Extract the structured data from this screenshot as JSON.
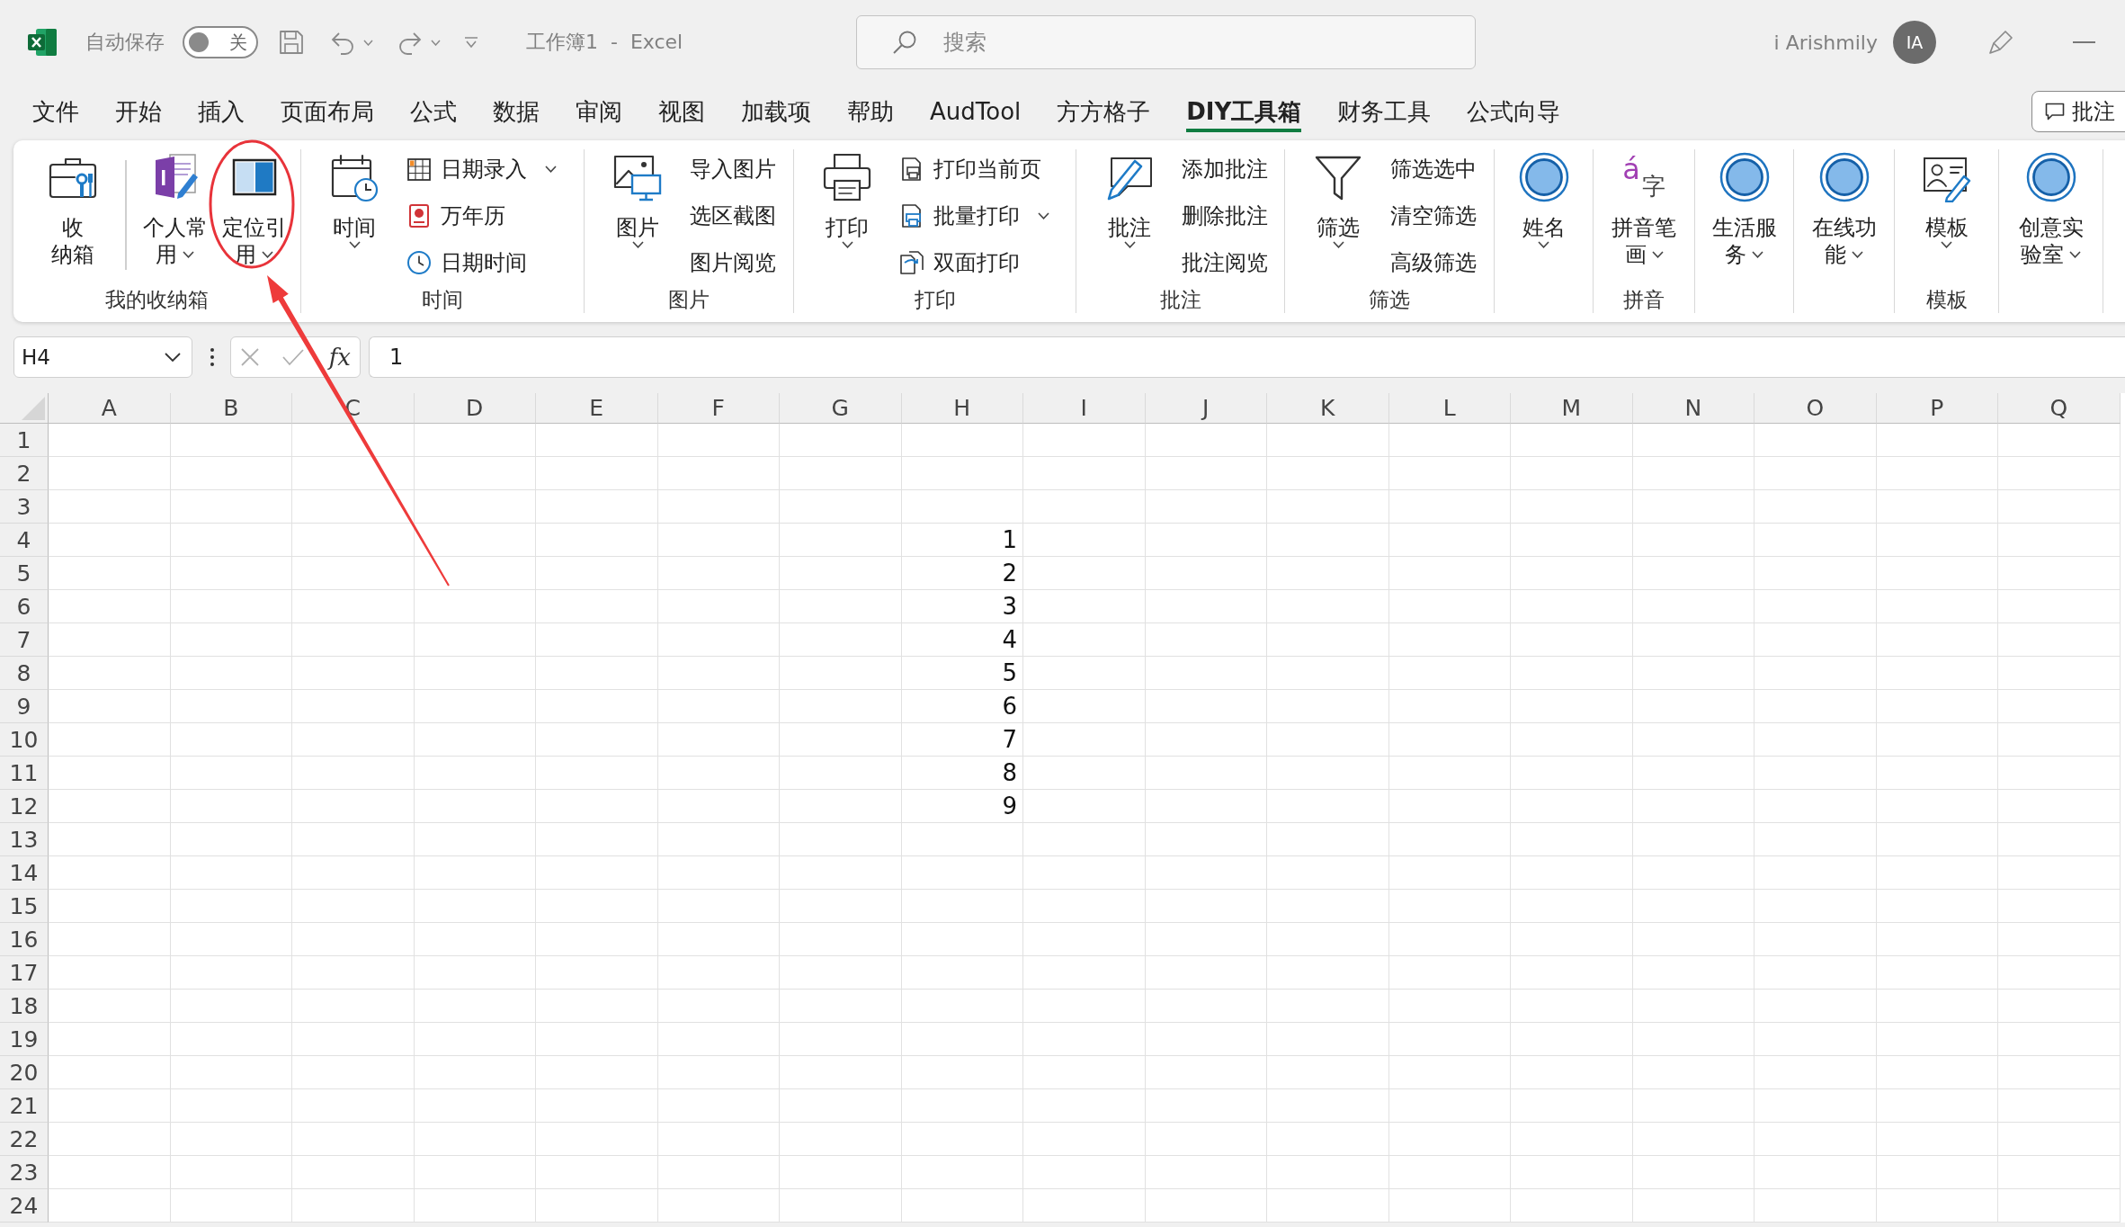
{
  "title_bar": {
    "autosave_label": "自动保存",
    "autosave": {
      "on": false,
      "label": "关"
    },
    "document_title": "工作簿1  -  Excel",
    "search": {
      "placeholder": "搜索"
    },
    "user_name": "i Arishmily",
    "avatar_initials": "IA"
  },
  "menu_tabs": [
    {
      "label": "文件",
      "selected": false
    },
    {
      "label": "开始",
      "selected": false
    },
    {
      "label": "插入",
      "selected": false
    },
    {
      "label": "页面布局",
      "selected": false
    },
    {
      "label": "公式",
      "selected": false
    },
    {
      "label": "数据",
      "selected": false
    },
    {
      "label": "审阅",
      "selected": false
    },
    {
      "label": "视图",
      "selected": false
    },
    {
      "label": "加载项",
      "selected": false
    },
    {
      "label": "帮助",
      "selected": false
    },
    {
      "label": "AudTool",
      "selected": false
    },
    {
      "label": "方方格子",
      "selected": false
    },
    {
      "label": "DIY工具箱",
      "selected": true
    },
    {
      "label": "财务工具",
      "selected": false
    },
    {
      "label": "公式向导",
      "selected": false
    }
  ],
  "comments_button": {
    "label": "批注"
  },
  "ribbon": {
    "groups": [
      {
        "label": "我的收纳箱",
        "items": [
          {
            "kind": "large",
            "lines": [
              "收",
              "纳箱"
            ],
            "dropdown": false
          },
          {
            "kind": "divider"
          },
          {
            "kind": "large",
            "lines": [
              "个人常",
              "用"
            ],
            "dropdown": true
          },
          {
            "kind": "large",
            "lines": [
              "定位引",
              "用"
            ],
            "dropdown": true
          }
        ]
      },
      {
        "label": "时间",
        "items": [
          {
            "kind": "large",
            "lines": [
              "时间"
            ],
            "dropdown": true
          },
          {
            "kind": "stack",
            "entries": [
              {
                "label": "日期录入",
                "dropdown": true
              },
              {
                "label": "万年历",
                "dropdown": false
              },
              {
                "label": "日期时间",
                "dropdown": false
              }
            ]
          }
        ]
      },
      {
        "label": "图片",
        "items": [
          {
            "kind": "large",
            "lines": [
              "图片"
            ],
            "dropdown": true
          },
          {
            "kind": "stack",
            "entries": [
              {
                "label": "导入图片",
                "dropdown": false
              },
              {
                "label": "选区截图",
                "dropdown": false
              },
              {
                "label": "图片阅览",
                "dropdown": false
              }
            ]
          }
        ]
      },
      {
        "label": "打印",
        "items": [
          {
            "kind": "large",
            "lines": [
              "打印"
            ],
            "dropdown": true
          },
          {
            "kind": "stack",
            "entries": [
              {
                "label": "打印当前页",
                "dropdown": false
              },
              {
                "label": "批量打印",
                "dropdown": true
              },
              {
                "label": "双面打印",
                "dropdown": false
              }
            ]
          }
        ]
      },
      {
        "label": "批注",
        "items": [
          {
            "kind": "large",
            "lines": [
              "批注"
            ],
            "dropdown": true
          },
          {
            "kind": "stack",
            "entries": [
              {
                "label": "添加批注",
                "dropdown": false
              },
              {
                "label": "删除批注",
                "dropdown": false
              },
              {
                "label": "批注阅览",
                "dropdown": false
              }
            ]
          }
        ]
      },
      {
        "label": "筛选",
        "items": [
          {
            "kind": "large",
            "lines": [
              "筛选"
            ],
            "dropdown": true
          },
          {
            "kind": "stack",
            "entries": [
              {
                "label": "筛选选中",
                "dropdown": false
              },
              {
                "label": "清空筛选",
                "dropdown": false
              },
              {
                "label": "高级筛选",
                "dropdown": false
              }
            ]
          }
        ]
      },
      {
        "items": [
          {
            "kind": "large",
            "lines": [
              "姓名"
            ],
            "dropdown": true
          }
        ]
      },
      {
        "label": "拼音",
        "items": [
          {
            "kind": "large",
            "lines": [
              "拼音笔",
              "画"
            ],
            "dropdown": true,
            "icon_glyphs": [
              "á",
              "字"
            ]
          }
        ]
      },
      {
        "items": [
          {
            "kind": "large",
            "lines": [
              "生活服",
              "务"
            ],
            "dropdown": true
          }
        ]
      },
      {
        "items": [
          {
            "kind": "large",
            "lines": [
              "在线功",
              "能"
            ],
            "dropdown": true
          }
        ]
      },
      {
        "label": "模板",
        "items": [
          {
            "kind": "large",
            "lines": [
              "模板"
            ],
            "dropdown": true
          }
        ]
      },
      {
        "items": [
          {
            "kind": "large",
            "lines": [
              "创意实",
              "验室"
            ],
            "dropdown": true
          }
        ]
      }
    ]
  },
  "formula_bar": {
    "name_box": "H4",
    "edit_disabled": true,
    "function_label": "fx",
    "value": "1"
  },
  "sheet": {
    "columns": [
      "A",
      "B",
      "C",
      "D",
      "E",
      "F",
      "G",
      "H",
      "I",
      "J",
      "K",
      "L",
      "M",
      "N",
      "O",
      "P",
      "Q"
    ],
    "rows": [
      {
        "label": "1"
      },
      {
        "label": "2"
      },
      {
        "label": "3"
      },
      {
        "label": "4",
        "cells": [
          null,
          null,
          null,
          null,
          null,
          null,
          null,
          "1"
        ]
      },
      {
        "label": "5",
        "cells": [
          null,
          null,
          null,
          null,
          null,
          null,
          null,
          "2"
        ]
      },
      {
        "label": "6",
        "cells": [
          null,
          null,
          null,
          null,
          null,
          null,
          null,
          "3"
        ]
      },
      {
        "label": "7",
        "cells": [
          null,
          null,
          null,
          null,
          null,
          null,
          null,
          "4"
        ]
      },
      {
        "label": "8",
        "cells": [
          null,
          null,
          null,
          null,
          null,
          null,
          null,
          "5"
        ]
      },
      {
        "label": "9",
        "cells": [
          null,
          null,
          null,
          null,
          null,
          null,
          null,
          "6"
        ]
      },
      {
        "label": "10",
        "cells": [
          null,
          null,
          null,
          null,
          null,
          null,
          null,
          "7"
        ]
      },
      {
        "label": "11",
        "cells": [
          null,
          null,
          null,
          null,
          null,
          null,
          null,
          "8"
        ]
      },
      {
        "label": "12",
        "cells": [
          null,
          null,
          null,
          null,
          null,
          null,
          null,
          "9"
        ]
      },
      {
        "label": "13"
      },
      {
        "label": "14"
      },
      {
        "label": "15"
      },
      {
        "label": "16"
      },
      {
        "label": "17"
      },
      {
        "label": "18"
      },
      {
        "label": "19"
      },
      {
        "label": "20"
      },
      {
        "label": "21"
      },
      {
        "label": "22"
      },
      {
        "label": "23"
      },
      {
        "label": "24"
      }
    ]
  }
}
